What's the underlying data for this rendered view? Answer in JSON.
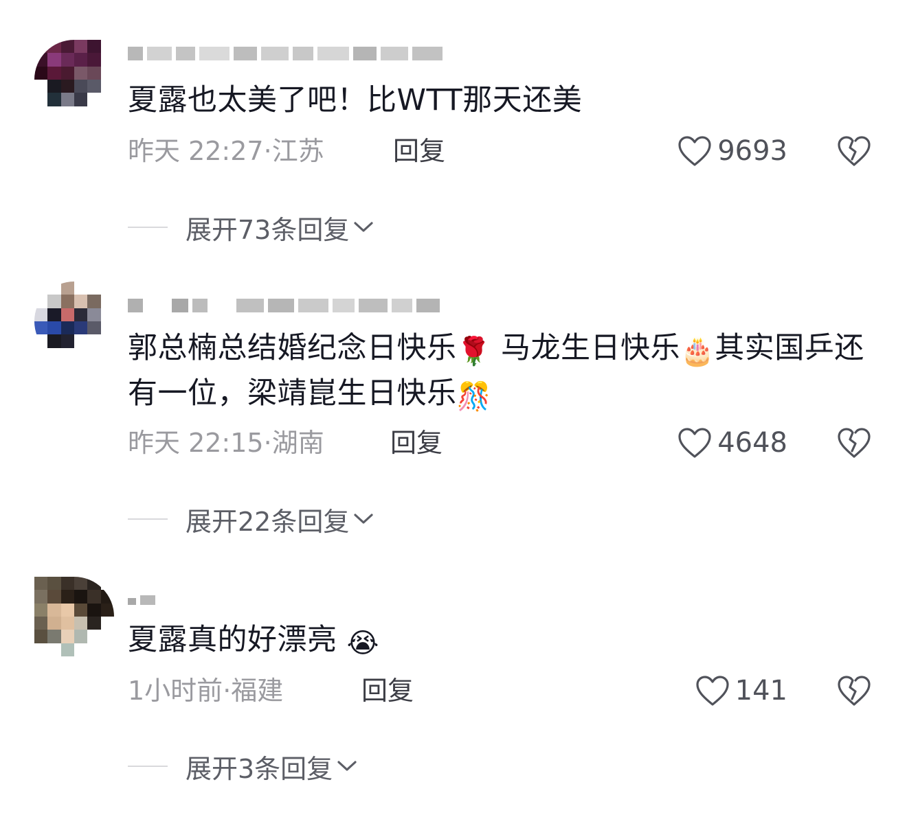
{
  "comments": [
    {
      "text": "夏露也太美了吧！比WTT那天还美",
      "time": "昨天 22:27",
      "location": "江苏",
      "reply_label": "回复",
      "likes": "9693",
      "expand_label": "展开73条回复"
    },
    {
      "text_part1": "郭总楠总结婚纪念日快乐",
      "emoji1": "🌹",
      "text_part2": " 马龙生日快乐",
      "emoji2": "🎂",
      "text_part3": "其实国乒还有一位，梁靖崑生日快乐",
      "emoji3": "🎊",
      "time": "昨天 22:15",
      "location": "湖南",
      "reply_label": "回复",
      "likes": "4648",
      "expand_label": "展开22条回复"
    },
    {
      "text": "夏露真的好漂亮 ",
      "emoji": "😭",
      "time": "1小时前",
      "location": "福建",
      "reply_label": "回复",
      "likes": "141",
      "expand_label": "展开3条回复"
    }
  ],
  "separator": "·",
  "icons": {
    "like": "heart-outline-icon",
    "dislike": "broken-heart-icon",
    "expand": "chevron-down-icon"
  },
  "colors": {
    "text": "#161823",
    "meta": "#9a9a9f",
    "action": "#3c3d45"
  }
}
